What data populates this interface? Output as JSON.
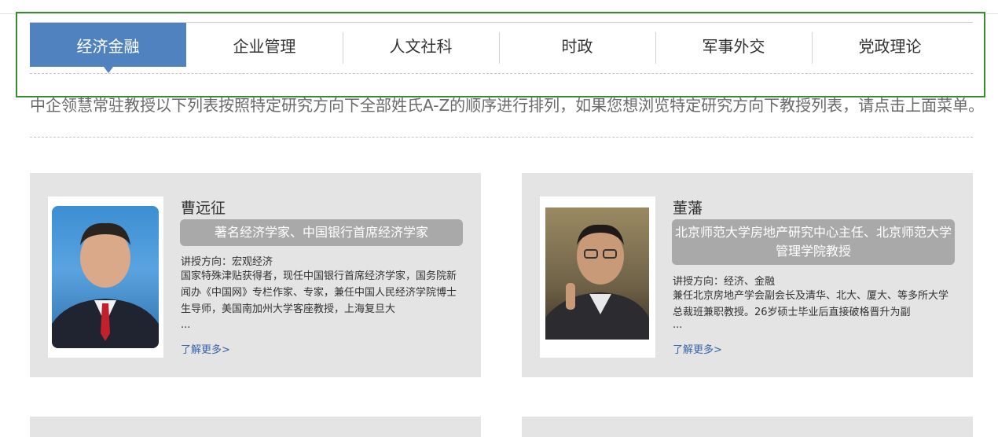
{
  "tabs": [
    {
      "label": "经济金融",
      "active": true
    },
    {
      "label": "企业管理",
      "active": false
    },
    {
      "label": "人文社科",
      "active": false
    },
    {
      "label": "时政",
      "active": false
    },
    {
      "label": "军事外交",
      "active": false
    },
    {
      "label": "党政理论",
      "active": false
    }
  ],
  "intro": "中企领慧常驻教授以下列表按照特定研究方向下全部姓氏A-Z的顺序进行排列，如果您想浏览特定研究方向下教授列表，请点击上面菜单。",
  "professors": [
    {
      "name": "曹远征",
      "title": "著名经济学家、中国银行首席经济学家",
      "direction": "讲授方向：宏观经济",
      "desc": "国家特殊津贴获得者，现任中国银行首席经济学家，国务院新闻办《中国网》专栏作家、专家，兼任中国人民经济学院博士生导师，美国南加州大学客座教授，上海复旦大",
      "ellipsis": "...",
      "more": "了解更多>"
    },
    {
      "name": "董藩",
      "title": "北京师范大学房地产研究中心主任、北京师范大学管理学院教授",
      "direction": "讲授方向：经济、金融",
      "desc": "兼任北京房地产学会副会长及清华、北大、厦大、等多所大学总裁班兼职教授。26岁硕士毕业后直接破格晋升为副",
      "ellipsis": "...",
      "more": "了解更多>"
    }
  ],
  "colors": {
    "active_tab": "#5182c0",
    "card_bg": "#e4e4e4",
    "badge_bg": "#a9a9a9",
    "link": "#3a63a8",
    "highlight_border": "#3a8a31"
  }
}
